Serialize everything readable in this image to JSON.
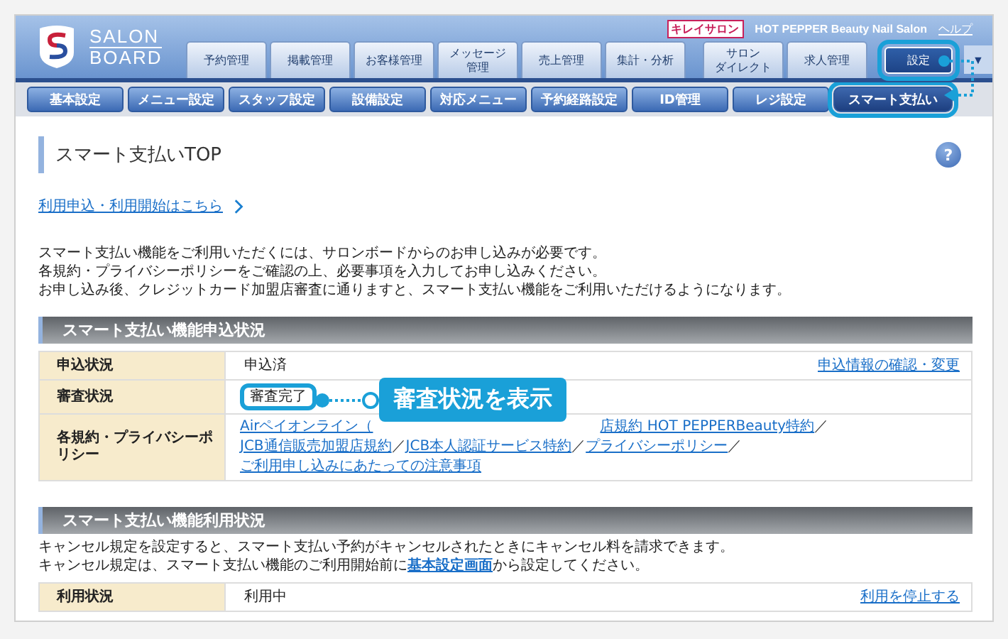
{
  "logo": {
    "line1": "SALON",
    "line2": "BOARD"
  },
  "header_links": {
    "badge": "キレイサロン",
    "salon_name": "HOT PEPPER Beauty Nail Salon",
    "help": "ヘルプ"
  },
  "main_tabs": [
    {
      "label": "予約管理",
      "selected": false,
      "highlighted": false
    },
    {
      "label": "掲載管理",
      "selected": false,
      "highlighted": false
    },
    {
      "label": "お客様管理",
      "selected": false,
      "highlighted": false
    },
    {
      "lines": [
        "メッセージ",
        "管理"
      ],
      "selected": false,
      "highlighted": false
    },
    {
      "label": "売上管理",
      "selected": false,
      "highlighted": false
    },
    {
      "label": "集計・分析",
      "selected": false,
      "highlighted": false
    },
    {
      "lines": [
        "サロン",
        "ダイレクト"
      ],
      "selected": false,
      "highlighted": false
    },
    {
      "label": "求人管理",
      "selected": false,
      "highlighted": false
    },
    {
      "label": "設定",
      "selected": true,
      "highlighted": true
    }
  ],
  "dropdown": {
    "label": "▼"
  },
  "sub_tabs": [
    {
      "label": "基本設定",
      "selected": false,
      "highlighted": false
    },
    {
      "label": "メニュー設定",
      "selected": false,
      "highlighted": false
    },
    {
      "label": "スタッフ設定",
      "selected": false,
      "highlighted": false
    },
    {
      "label": "設備設定",
      "selected": false,
      "highlighted": false
    },
    {
      "label": "対応メニュー",
      "selected": false,
      "highlighted": false
    },
    {
      "label": "予約経路設定",
      "selected": false,
      "highlighted": false
    },
    {
      "label": "ID管理",
      "selected": false,
      "highlighted": false
    },
    {
      "label": "レジ設定",
      "selected": false,
      "highlighted": false
    },
    {
      "label": "スマート支払い",
      "selected": true,
      "highlighted": true
    }
  ],
  "page_title": "スマート支払いTOP",
  "help_icon": "?",
  "apply_link": "利用申込・利用開始はこちら",
  "intro": [
    "スマート支払い機能をご利用いただくには、サロンボードからのお申し込みが必要です。",
    "各規約・プライバシーポリシーをご確認の上、必要事項を入力してお申し込みください。",
    "お申し込み後、クレジットカード加盟店審査に通りますと、スマート支払い機能をご利用いただけるようになります。"
  ],
  "sections": [
    {
      "title": "スマート支払い機能申込状況",
      "rows": [
        {
          "kind": "text",
          "label": "申込状況",
          "value": "申込済",
          "link": "申込情報の確認・変更",
          "highlighted": false
        },
        {
          "kind": "text",
          "label": "審査状況",
          "value": "審査完了",
          "highlighted": true
        },
        {
          "kind": "links",
          "label": "各規約・プライバシーポリシー",
          "links": [
            "Airペイオンライン（",
            "店規約 HOT PEPPERBeauty特約",
            "JCB通信販売加盟店規約",
            "JCB本人認証サービス特約",
            "プライバシーポリシー",
            "ご利用申し込みにあたっての注意事項"
          ],
          "separator": "／"
        }
      ]
    },
    {
      "title": "スマート支払い機能利用状況",
      "notes": [
        {
          "before": "キャンセル規定を設定すると、スマート支払い予約がキャンセルされたときにキャンセル料を請求できます。"
        },
        {
          "before": "キャンセル規定は、スマート支払い機能のご利用開始前に",
          "link": "基本設定画面",
          "after": "から設定してください。"
        }
      ],
      "rows": [
        {
          "kind": "text",
          "label": "利用状況",
          "value": "利用中",
          "link": "利用を停止する",
          "highlighted": false
        }
      ]
    }
  ],
  "callout": {
    "label": "審査状況を表示"
  }
}
